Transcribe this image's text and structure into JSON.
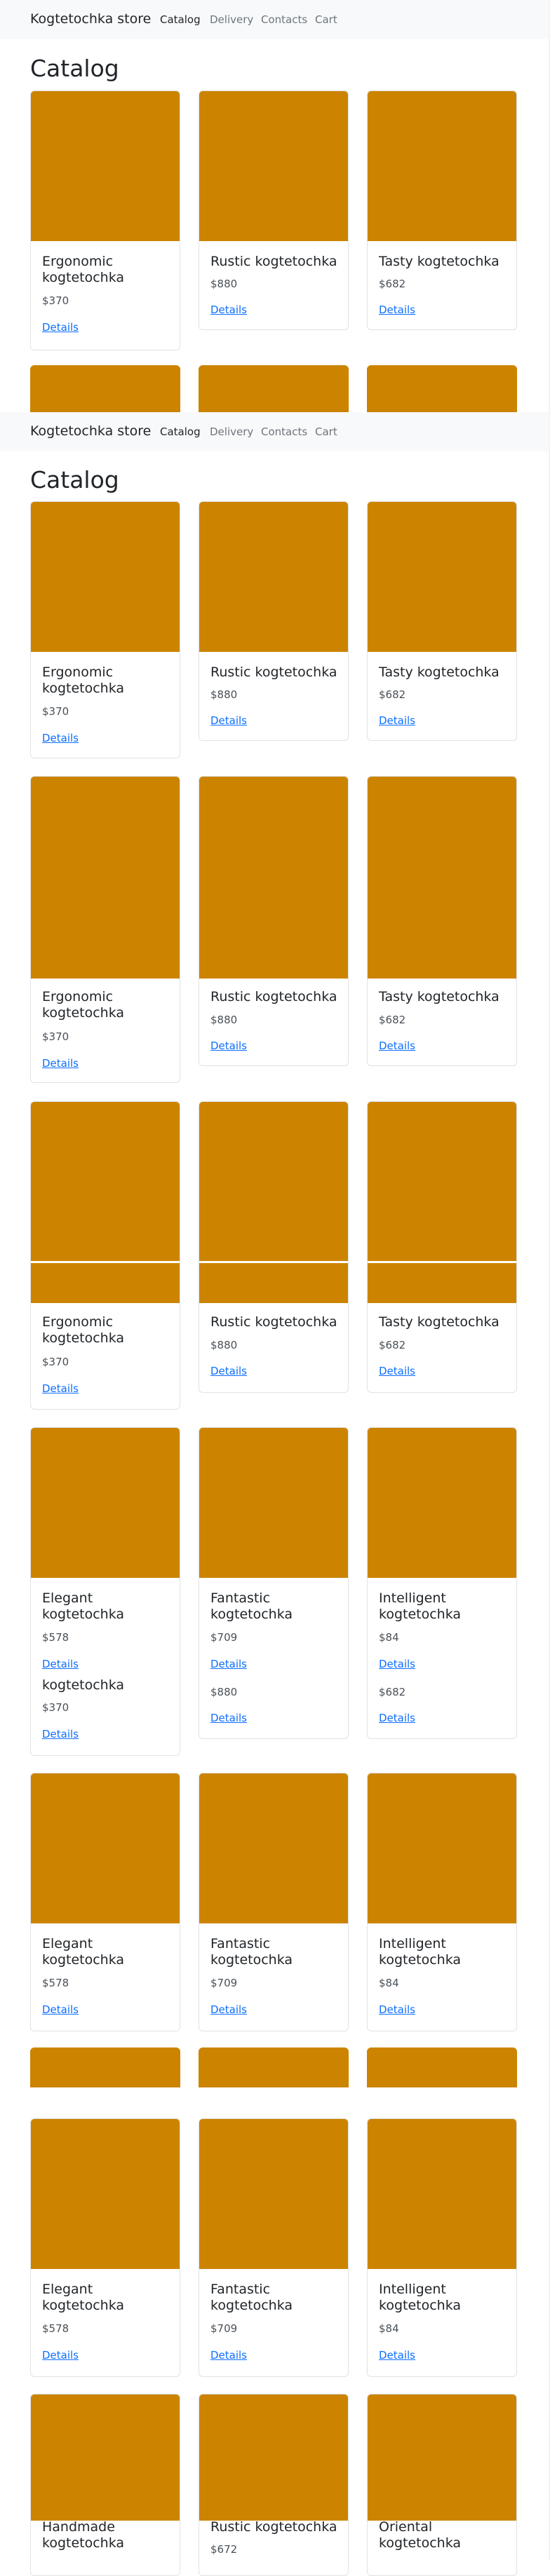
{
  "store": {
    "brand": "Kogtetochka store",
    "nav": [
      {
        "label": "Catalog",
        "active": true
      },
      {
        "label": "Delivery",
        "active": false
      },
      {
        "label": "Contacts",
        "active": false
      },
      {
        "label": "Cart",
        "active": false
      }
    ],
    "page_title": "Catalog"
  },
  "colors": {
    "image_placeholder": "#cc8400",
    "link": "#0d6efd",
    "navbar_bg": "#f8f9fa"
  },
  "products": {
    "ergonomic": {
      "name": "Ergonomic kogtetochka",
      "price": "$370",
      "link": "Details"
    },
    "rustic": {
      "name": "Rustic kogtetochka",
      "price": "$880",
      "link": "Details"
    },
    "tasty": {
      "name": "Tasty kogtetochka",
      "price": "$682",
      "link": "Details"
    },
    "elegant": {
      "name": "Elegant kogtetochka",
      "price": "$578",
      "link": "Details"
    },
    "fantastic": {
      "name": "Fantastic kogtetochka",
      "price": "$709",
      "link": "Details"
    },
    "intelligent": {
      "name": "Intelligent kogtetochka",
      "price": "$84",
      "link": "Details"
    },
    "handmade": {
      "name": "Handmade kogtetochka"
    },
    "rustic2": {
      "name": "Rustic kogtetochka",
      "price": "$672"
    },
    "oriental": {
      "name": "Oriental kogtetochka"
    }
  },
  "fragments": {
    "ergonomic_tail": "kogtetochka"
  }
}
